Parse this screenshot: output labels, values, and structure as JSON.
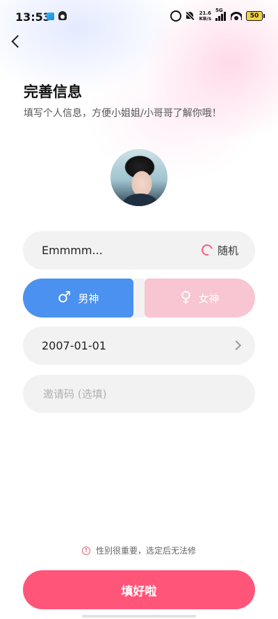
{
  "status_bar": {
    "time": "13:53",
    "net_speed_value": "21.6",
    "net_speed_unit": "KB/s",
    "network_type": "5G",
    "battery_level": "50",
    "icons": [
      "app-notification-icon",
      "qq-icon",
      "alarm-icon",
      "mute-bell-icon",
      "signal-icon",
      "wifi-icon",
      "battery-icon"
    ]
  },
  "header": {
    "back_icon": "chevron-left-icon",
    "title": "完善信息",
    "subtitle": "填写个人信息，方便小姐姐/小哥哥了解你哦！"
  },
  "form": {
    "nickname": {
      "value": "Emmmm...",
      "random_label": "随机",
      "random_icon": "refresh-icon"
    },
    "gender": {
      "options": [
        {
          "symbol": "♂",
          "label": "男神",
          "selected": true,
          "color": "#4b91ef"
        },
        {
          "symbol": "♀",
          "label": "女神",
          "selected": false,
          "color": "#f8c5d2"
        }
      ]
    },
    "birthday": {
      "value": "2007-01-01"
    },
    "invite_code": {
      "value": "",
      "placeholder": "邀请码 (选填)"
    }
  },
  "notice": {
    "icon": "info-icon",
    "text": "性别很重要，选定后无法修"
  },
  "submit": {
    "label": "填好啦",
    "color": "#ff5578"
  }
}
